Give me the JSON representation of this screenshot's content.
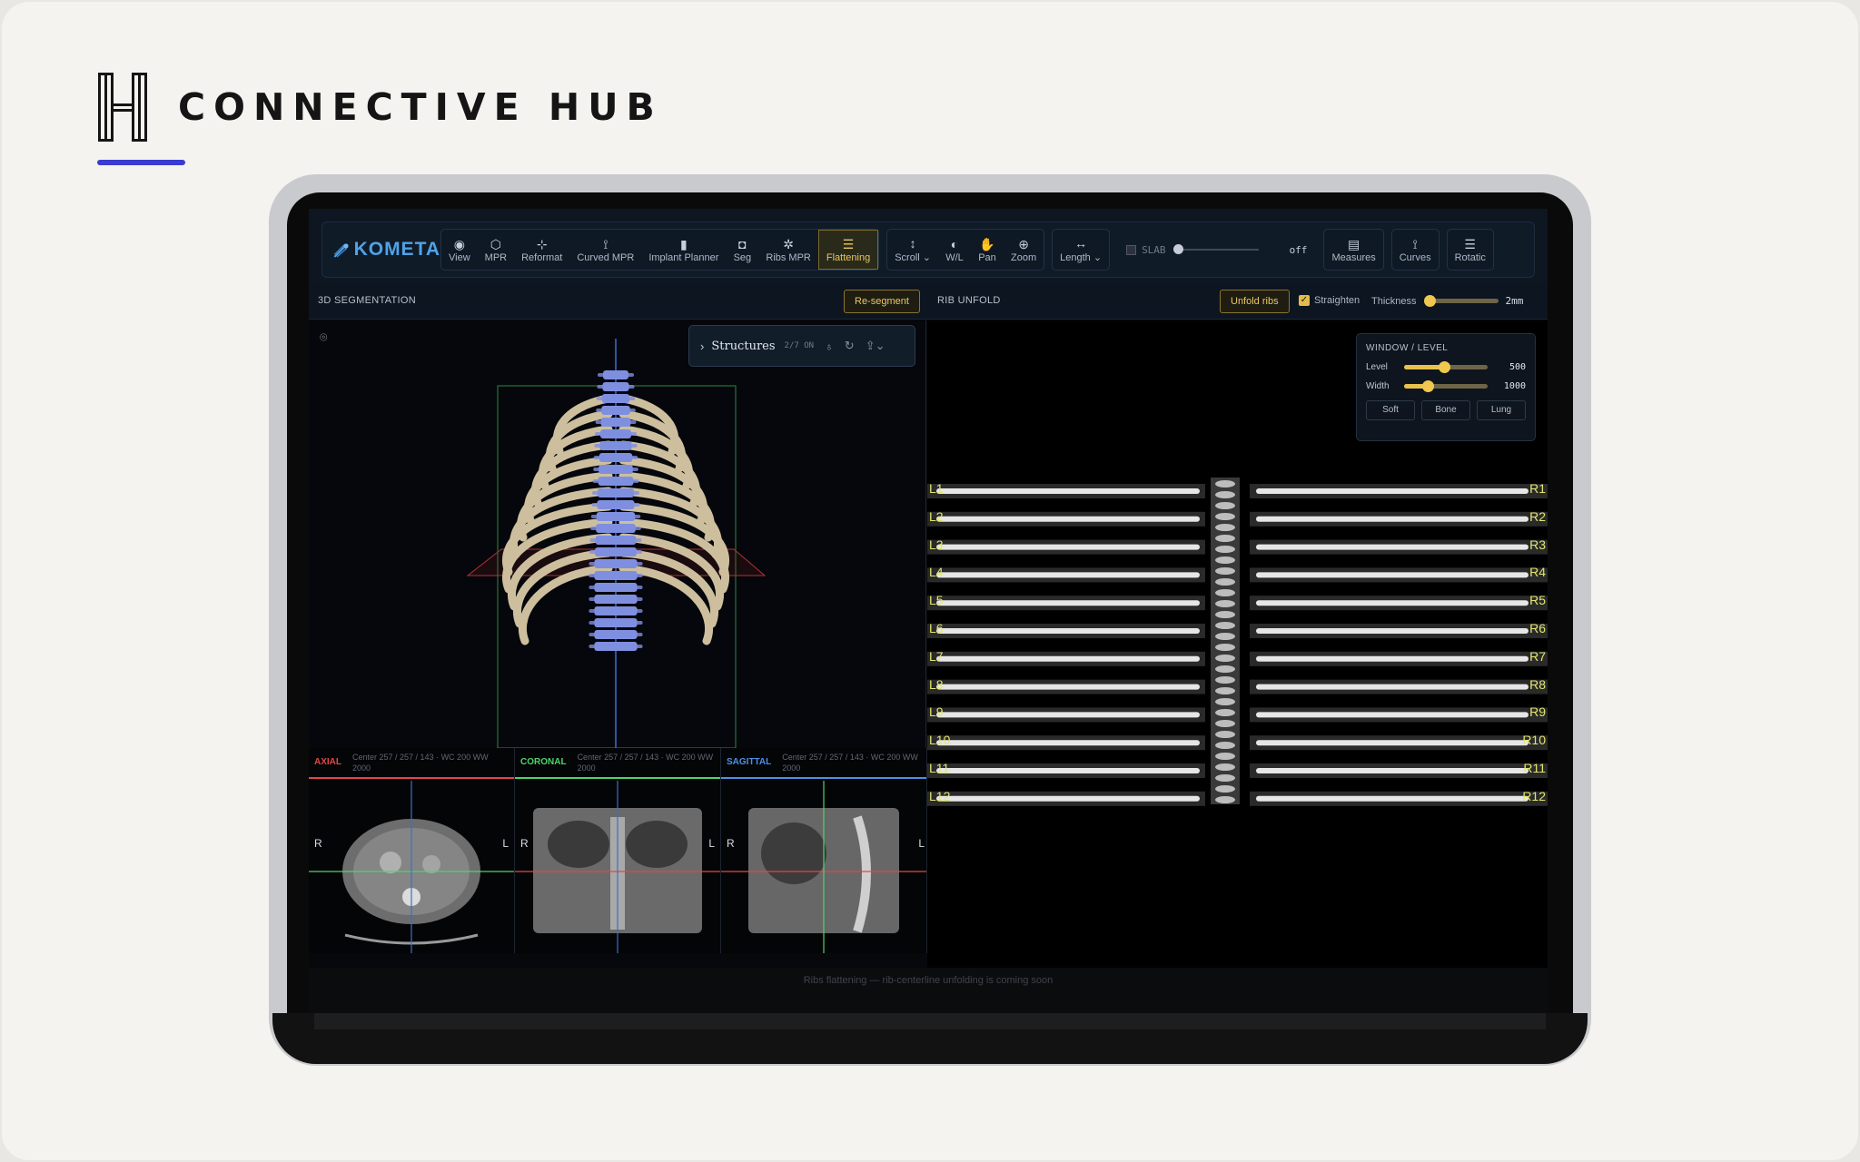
{
  "brand": {
    "name": "CONNECTIVE HUB"
  },
  "app": {
    "logo_text": "KOMETA"
  },
  "toolbar": {
    "tools": [
      {
        "label": "View",
        "icon": "eye-icon"
      },
      {
        "label": "MPR",
        "icon": "cube-icon"
      },
      {
        "label": "Reformat",
        "icon": "reformat-icon"
      },
      {
        "label": "Curved MPR",
        "icon": "curve-icon"
      },
      {
        "label": "Implant Planner",
        "icon": "implant-icon"
      },
      {
        "label": "Seg",
        "icon": "segment-icon"
      },
      {
        "label": "Ribs MPR",
        "icon": "ribs-icon"
      },
      {
        "label": "Flattening",
        "icon": "list-icon",
        "active": true
      }
    ],
    "nav": [
      {
        "label": "Scroll",
        "icon": "scroll-icon",
        "dropdown": true
      },
      {
        "label": "W/L",
        "icon": "contrast-icon"
      },
      {
        "label": "Pan",
        "icon": "hand-icon"
      },
      {
        "label": "Zoom",
        "icon": "zoom-icon"
      }
    ],
    "length": {
      "label": "Length",
      "icon": "ruler-icon"
    },
    "slab": {
      "label": "SLAB",
      "value": "off"
    },
    "right": [
      {
        "label": "Measures",
        "icon": "measures-icon"
      },
      {
        "label": "Curves",
        "icon": "curves-icon"
      },
      {
        "label": "Rotatic",
        "icon": "rotation-icon"
      }
    ]
  },
  "segmentation": {
    "title": "3D SEGMENTATION",
    "resegment_label": "Re-segment",
    "structures_label": "Structures",
    "structures_count": "2/7 ON"
  },
  "unfold": {
    "title": "RIB UNFOLD",
    "unfold_label": "Unfold ribs",
    "straighten_label": "Straighten",
    "straighten_checked": true,
    "thickness_label": "Thickness",
    "thickness_value": "2mm",
    "left_labels": [
      "L1",
      "L2",
      "L3",
      "L4",
      "L5",
      "L6",
      "L7",
      "L8",
      "L9",
      "L10",
      "L11",
      "L12"
    ],
    "right_labels": [
      "R1",
      "R2",
      "R3",
      "R4",
      "R5",
      "R6",
      "R7",
      "R8",
      "R9",
      "R10",
      "R11",
      "R12"
    ]
  },
  "window_level": {
    "title": "WINDOW / LEVEL",
    "level_label": "Level",
    "level_value": "500",
    "level_fraction": 0.48,
    "width_label": "Width",
    "width_value": "1000",
    "width_fraction": 0.28,
    "presets": [
      "Soft",
      "Bone",
      "Lung"
    ]
  },
  "mpr": [
    {
      "name": "AXIAL",
      "color": "#e04848",
      "info": "Center 257 / 257 / 143 · WC 200 WW 2000",
      "left": "R",
      "right": "L"
    },
    {
      "name": "CORONAL",
      "color": "#4fd46b",
      "info": "Center 257 / 257 / 143 · WC 200 WW 2000",
      "left": "R",
      "right": "L"
    },
    {
      "name": "SAGITTAL",
      "color": "#4d8fe6",
      "info": "Center 257 / 257 / 143 · WC 200 WW 2000",
      "left": "R",
      "right": "L"
    }
  ],
  "status": {
    "footer": "Ribs flattening — rib-centerline unfolding is coming soon"
  },
  "colors": {
    "accent": "#e9c24c",
    "spine": "#7f8fe0",
    "ribs": "#d7ccb0",
    "brand_underline": "#3b3bd0"
  }
}
